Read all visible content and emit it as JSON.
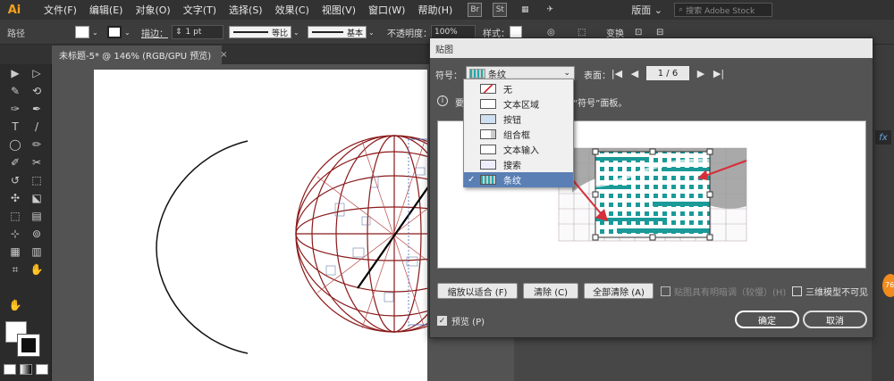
{
  "app": {
    "logo": "Ai"
  },
  "menu": [
    "文件(F)",
    "编辑(E)",
    "对象(O)",
    "文字(T)",
    "选择(S)",
    "效果(C)",
    "视图(V)",
    "窗口(W)",
    "帮助(H)"
  ],
  "menubar_icons": [
    "Br",
    "St",
    "▦",
    "✈"
  ],
  "workspace": "版面 ⌄",
  "search_placeholder": "搜索 Adobe Stock",
  "control": {
    "object_type": "路径",
    "stroke_label": "描边：",
    "stroke_weight": "1 pt",
    "profile_label": "等比",
    "brush_label": "基本",
    "opacity_label": "不透明度：",
    "opacity_value": "100%",
    "style_label": "样式：",
    "transform_label": "变换"
  },
  "document_tab": {
    "title": "未标题-5* @ 146% (RGB/GPU 预览)",
    "close": "×"
  },
  "tools": [
    "▶",
    "▷",
    "✎",
    "⟲",
    "✑",
    "✒",
    "T",
    "/",
    "◯",
    "✏",
    "✐",
    "✂",
    "↺",
    "⬚",
    "✣",
    "⬕",
    "⬚",
    "▤",
    "⊹",
    "⊚",
    "▦",
    "▥",
    "⌗",
    "✋",
    "🔍"
  ],
  "dialog": {
    "title": "贴图",
    "symbol_label": "符号：",
    "symbol_value": "条纹",
    "surface_label": "表面：",
    "nav_first": "|◀",
    "nav_prev": "◀",
    "page_value": "1 / 6",
    "nav_next": "▶",
    "nav_last": "▶|",
    "info_icon": "i",
    "info_prefix": "要",
    "info_suffix": "“符号”面板。",
    "scale_to_fit": "缩放以适合 (F)",
    "clear": "清除 (C)",
    "clear_all": "全部清除 (A)",
    "shade_artwork": "贴图具有明暗调（较慢）(H)",
    "invisible_geometry": "三维模型不可见",
    "preview": "预览 (P)",
    "ok": "确定",
    "cancel": "取消"
  },
  "dropdown": {
    "items": [
      "无",
      "文本区域",
      "按钮",
      "组合框",
      "文本输入",
      "搜索",
      "条纹"
    ],
    "selected_index": 6,
    "checkmark": "✓"
  },
  "right_panel": {
    "fx_label": "fx",
    "badge": "76"
  },
  "colors": {
    "accent": "#f7a21b",
    "teal": "#1a9a98",
    "selection": "#5a7fb5",
    "guide_red": "#d62f3a"
  }
}
